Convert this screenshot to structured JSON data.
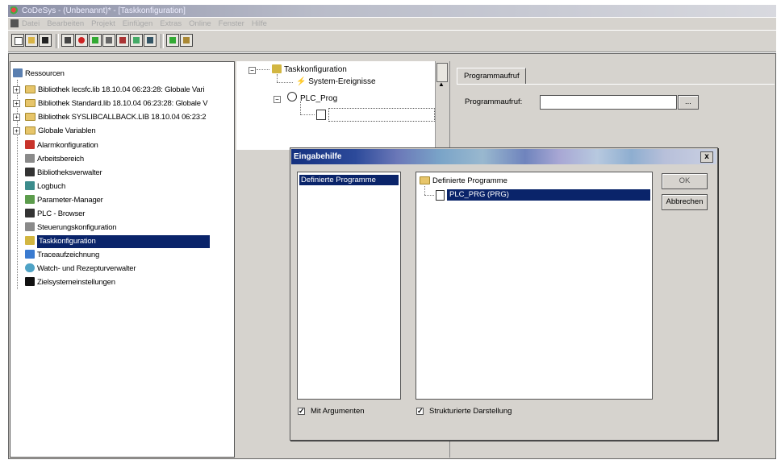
{
  "window": {
    "title": "CoDeSys - (Unbenannt)* - [Taskkonfiguration]"
  },
  "menu": {
    "items": [
      "Datei",
      "Bearbeiten",
      "Projekt",
      "Einfügen",
      "Extras",
      "Online",
      "Fenster",
      "Hilfe"
    ]
  },
  "resources_tree": {
    "root_label": "Ressourcen",
    "items": [
      {
        "label": "Bibliothek Iecsfc.lib 18.10.04 06:23:28: Globale Vari",
        "icon": "folder-icon",
        "expand": true
      },
      {
        "label": "Bibliothek Standard.lib 18.10.04 06:23:28: Globale V",
        "icon": "folder-icon",
        "expand": true
      },
      {
        "label": "Bibliothek SYSLIBCALLBACK.LIB 18.10.04 06:23:2",
        "icon": "folder-icon",
        "expand": true
      },
      {
        "label": "Globale Variablen",
        "icon": "folder-icon",
        "expand": true
      },
      {
        "label": "Alarmkonfiguration",
        "icon": "alarm-icon",
        "expand": false
      },
      {
        "label": "Arbeitsbereich",
        "icon": "workspace-icon",
        "expand": false
      },
      {
        "label": "Bibliotheksverwalter",
        "icon": "library-icon",
        "expand": false
      },
      {
        "label": "Logbuch",
        "icon": "logbook-icon",
        "expand": false
      },
      {
        "label": "Parameter-Manager",
        "icon": "parameter-icon",
        "expand": false
      },
      {
        "label": "PLC - Browser",
        "icon": "browser-icon",
        "expand": false
      },
      {
        "label": "Steuerungskonfiguration",
        "icon": "plc-config-icon",
        "expand": false
      },
      {
        "label": "Taskkonfiguration",
        "icon": "task-config-icon",
        "expand": false,
        "selected": true
      },
      {
        "label": "Traceaufzeichnung",
        "icon": "trace-icon",
        "expand": false
      },
      {
        "label": "Watch- und Rezepturverwalter",
        "icon": "watch-icon",
        "expand": false
      },
      {
        "label": "Zielsystemeinstellungen",
        "icon": "target-icon",
        "expand": false
      }
    ]
  },
  "task_tree": {
    "root_label": "Taskkonfiguration",
    "system_events": "System-Ereignisse",
    "task_name": "PLC_Prog"
  },
  "program_call": {
    "tab_label": "Programmaufruf",
    "field_label": "Programmaufruf:",
    "field_value": "",
    "browse_label": "..."
  },
  "dialog": {
    "title": "Eingabehilfe",
    "close_label": "x",
    "left_items": [
      "Definierte Programme"
    ],
    "tree_root": "Definierte Programme",
    "tree_item": "PLC_PRG (PRG)",
    "ok_label": "OK",
    "cancel_label": "Abbrechen",
    "with_args_label": "Mit Argumenten",
    "structured_label": "Strukturierte Darstellung"
  },
  "colors": {
    "selection": "#0a246a",
    "face": "#d6d3ce"
  }
}
